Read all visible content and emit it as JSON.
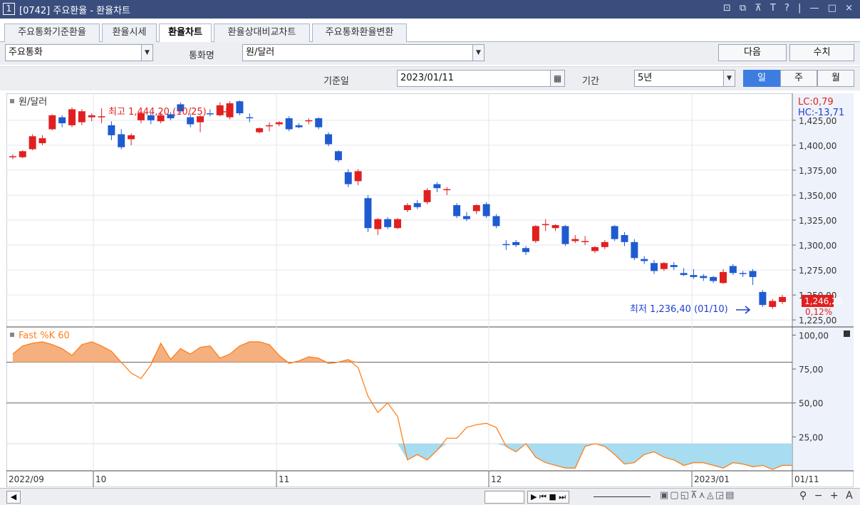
{
  "window": {
    "number": "1",
    "title": "[0742] 주요환율 - 환율차트",
    "controls": "⊡ ⧉ ⊼ T ? | — □ ×"
  },
  "tabs": [
    {
      "label": "주요통화기준환율"
    },
    {
      "label": "환율시세"
    },
    {
      "label": "환율차트"
    },
    {
      "label": "환율상대비교차트"
    },
    {
      "label": "주요통화환율변환"
    }
  ],
  "controls": {
    "category_value": "주요통화",
    "currency_label": "통화명",
    "currency_value": "원/달러",
    "next_label": "다음",
    "numeric_label": "수치",
    "date_label": "기준일",
    "date_value": "2023/01/11",
    "period_label": "기간",
    "period_value": "5년",
    "day_label": "일",
    "week_label": "주",
    "month_label": "월",
    "active_period_tab": "일"
  },
  "chart_data": [
    {
      "type": "candlestick",
      "title": "원/달러",
      "x_labels": [
        "2022/09",
        "10",
        "11",
        "12",
        "2023/01",
        "01/11"
      ],
      "y_ticks": [
        "1,425,00",
        "1,400,00",
        "1,375,00",
        "1,350,00",
        "1,325,00",
        "1,300,00",
        "1,275,00",
        "1,250,00",
        "1,225,00"
      ],
      "ylim": [
        1218,
        1452
      ],
      "annotations": {
        "high": "최고 1,444,20 (10/25)",
        "low": "최저 1,236,40 (01/10)",
        "lc": "LC:0,79",
        "hc": "HC:-13,71",
        "last_price": "1,246,20",
        "last_change": "0,12%"
      },
      "colors": {
        "up": "#e02020",
        "down": "#1f5bd0"
      },
      "candles": [
        {
          "o": 1388,
          "h": 1391,
          "l": 1386,
          "c": 1389
        },
        {
          "o": 1388,
          "h": 1395,
          "l": 1387,
          "c": 1394
        },
        {
          "o": 1396,
          "h": 1411,
          "l": 1395,
          "c": 1409
        },
        {
          "o": 1402,
          "h": 1410,
          "l": 1400,
          "c": 1407
        },
        {
          "o": 1416,
          "h": 1431,
          "l": 1415,
          "c": 1430
        },
        {
          "o": 1428,
          "h": 1430,
          "l": 1418,
          "c": 1422
        },
        {
          "o": 1420,
          "h": 1438,
          "l": 1418,
          "c": 1436
        },
        {
          "o": 1423,
          "h": 1436,
          "l": 1420,
          "c": 1434
        },
        {
          "o": 1428,
          "h": 1432,
          "l": 1424,
          "c": 1430
        },
        {
          "o": 1428,
          "h": 1437,
          "l": 1422,
          "c": 1429
        },
        {
          "o": 1420,
          "h": 1424,
          "l": 1405,
          "c": 1410
        },
        {
          "o": 1411,
          "h": 1416,
          "l": 1396,
          "c": 1398
        },
        {
          "o": 1406,
          "h": 1412,
          "l": 1400,
          "c": 1410
        },
        {
          "o": 1425,
          "h": 1434,
          "l": 1422,
          "c": 1432
        },
        {
          "o": 1430,
          "h": 1432,
          "l": 1421,
          "c": 1425
        },
        {
          "o": 1424,
          "h": 1433,
          "l": 1422,
          "c": 1430
        },
        {
          "o": 1431,
          "h": 1433,
          "l": 1425,
          "c": 1427
        },
        {
          "o": 1441,
          "h": 1443,
          "l": 1432,
          "c": 1434
        },
        {
          "o": 1428,
          "h": 1432,
          "l": 1418,
          "c": 1421
        },
        {
          "o": 1423,
          "h": 1430,
          "l": 1413,
          "c": 1429
        },
        {
          "o": 1432,
          "h": 1436,
          "l": 1429,
          "c": 1431
        },
        {
          "o": 1430,
          "h": 1443,
          "l": 1429,
          "c": 1440
        },
        {
          "o": 1428,
          "h": 1444,
          "l": 1426,
          "c": 1442
        },
        {
          "o": 1444,
          "h": 1445,
          "l": 1430,
          "c": 1432
        },
        {
          "o": 1428,
          "h": 1432,
          "l": 1423,
          "c": 1427
        },
        {
          "o": 1413,
          "h": 1418,
          "l": 1412,
          "c": 1417
        },
        {
          "o": 1419,
          "h": 1423,
          "l": 1414,
          "c": 1420
        },
        {
          "o": 1421,
          "h": 1424,
          "l": 1419,
          "c": 1423
        },
        {
          "o": 1427,
          "h": 1429,
          "l": 1414,
          "c": 1416
        },
        {
          "o": 1420,
          "h": 1422,
          "l": 1417,
          "c": 1418
        },
        {
          "o": 1424,
          "h": 1427,
          "l": 1421,
          "c": 1425
        },
        {
          "o": 1427,
          "h": 1428,
          "l": 1416,
          "c": 1418
        },
        {
          "o": 1411,
          "h": 1413,
          "l": 1399,
          "c": 1401
        },
        {
          "o": 1394,
          "h": 1395,
          "l": 1383,
          "c": 1385
        },
        {
          "o": 1373,
          "h": 1376,
          "l": 1358,
          "c": 1361
        },
        {
          "o": 1364,
          "h": 1376,
          "l": 1360,
          "c": 1374
        },
        {
          "o": 1347,
          "h": 1350,
          "l": 1313,
          "c": 1317
        },
        {
          "o": 1316,
          "h": 1327,
          "l": 1310,
          "c": 1326
        },
        {
          "o": 1326,
          "h": 1328,
          "l": 1316,
          "c": 1318
        },
        {
          "o": 1317,
          "h": 1327,
          "l": 1316,
          "c": 1326
        },
        {
          "o": 1335,
          "h": 1342,
          "l": 1333,
          "c": 1340
        },
        {
          "o": 1342,
          "h": 1345,
          "l": 1336,
          "c": 1338
        },
        {
          "o": 1343,
          "h": 1357,
          "l": 1341,
          "c": 1355
        },
        {
          "o": 1361,
          "h": 1363,
          "l": 1353,
          "c": 1357
        },
        {
          "o": 1355,
          "h": 1358,
          "l": 1350,
          "c": 1356
        },
        {
          "o": 1340,
          "h": 1342,
          "l": 1327,
          "c": 1329
        },
        {
          "o": 1329,
          "h": 1333,
          "l": 1324,
          "c": 1326
        },
        {
          "o": 1334,
          "h": 1341,
          "l": 1331,
          "c": 1340
        },
        {
          "o": 1341,
          "h": 1343,
          "l": 1327,
          "c": 1329
        },
        {
          "o": 1329,
          "h": 1331,
          "l": 1317,
          "c": 1319
        },
        {
          "o": 1301,
          "h": 1305,
          "l": 1295,
          "c": 1300
        },
        {
          "o": 1303,
          "h": 1305,
          "l": 1298,
          "c": 1300
        },
        {
          "o": 1297,
          "h": 1299,
          "l": 1290,
          "c": 1293
        },
        {
          "o": 1304,
          "h": 1320,
          "l": 1302,
          "c": 1319
        },
        {
          "o": 1320,
          "h": 1326,
          "l": 1314,
          "c": 1321
        },
        {
          "o": 1317,
          "h": 1321,
          "l": 1314,
          "c": 1320
        },
        {
          "o": 1319,
          "h": 1320,
          "l": 1299,
          "c": 1301
        },
        {
          "o": 1304,
          "h": 1310,
          "l": 1302,
          "c": 1306
        },
        {
          "o": 1304,
          "h": 1309,
          "l": 1300,
          "c": 1304
        },
        {
          "o": 1294,
          "h": 1299,
          "l": 1292,
          "c": 1298
        },
        {
          "o": 1298,
          "h": 1305,
          "l": 1296,
          "c": 1303
        },
        {
          "o": 1319,
          "h": 1320,
          "l": 1304,
          "c": 1306
        },
        {
          "o": 1310,
          "h": 1313,
          "l": 1299,
          "c": 1303
        },
        {
          "o": 1303,
          "h": 1306,
          "l": 1285,
          "c": 1287
        },
        {
          "o": 1286,
          "h": 1289,
          "l": 1281,
          "c": 1284
        },
        {
          "o": 1282,
          "h": 1285,
          "l": 1271,
          "c": 1274
        },
        {
          "o": 1276,
          "h": 1283,
          "l": 1274,
          "c": 1282
        },
        {
          "o": 1280,
          "h": 1283,
          "l": 1275,
          "c": 1278
        },
        {
          "o": 1272,
          "h": 1277,
          "l": 1269,
          "c": 1270
        },
        {
          "o": 1270,
          "h": 1276,
          "l": 1266,
          "c": 1268
        },
        {
          "o": 1269,
          "h": 1271,
          "l": 1264,
          "c": 1267
        },
        {
          "o": 1268,
          "h": 1269,
          "l": 1262,
          "c": 1264
        },
        {
          "o": 1262,
          "h": 1276,
          "l": 1261,
          "c": 1273
        },
        {
          "o": 1279,
          "h": 1281,
          "l": 1270,
          "c": 1272
        },
        {
          "o": 1272,
          "h": 1274,
          "l": 1268,
          "c": 1271
        },
        {
          "o": 1274,
          "h": 1276,
          "l": 1260,
          "c": 1268
        },
        {
          "o": 1253,
          "h": 1255,
          "l": 1238,
          "c": 1240
        },
        {
          "o": 1238,
          "h": 1246,
          "l": 1236,
          "c": 1244
        },
        {
          "o": 1243,
          "h": 1250,
          "l": 1241,
          "c": 1248
        }
      ]
    },
    {
      "type": "area",
      "title": "Fast %K 60",
      "y_ticks": [
        "100,00",
        "75,00",
        "50,00",
        "25,00"
      ],
      "ylim": [
        0,
        106
      ],
      "reference_lines": [
        80,
        50,
        20
      ],
      "colors": {
        "line": "#ff7f1a",
        "overbought_fill": "#f5b07f",
        "oversold_fill": "#a8dcf0"
      },
      "values": [
        86,
        92,
        94,
        95,
        93,
        90,
        85,
        93,
        95,
        92,
        88,
        80,
        72,
        68,
        78,
        94,
        82,
        90,
        86,
        91,
        92,
        83,
        86,
        92,
        95,
        95,
        93,
        85,
        79,
        81,
        84,
        83,
        79,
        80,
        82,
        76,
        55,
        43,
        50,
        40,
        8,
        12,
        8,
        15,
        24,
        24,
        32,
        34,
        35,
        32,
        18,
        14,
        20,
        10,
        6,
        4,
        2,
        2,
        18,
        20,
        18,
        12,
        5,
        6,
        12,
        14,
        10,
        8,
        4,
        6,
        6,
        4,
        2,
        6,
        5,
        3,
        4,
        1,
        4,
        4
      ]
    }
  ],
  "bottom": {
    "controls": "▶ ⏮ ■ ⏭"
  }
}
